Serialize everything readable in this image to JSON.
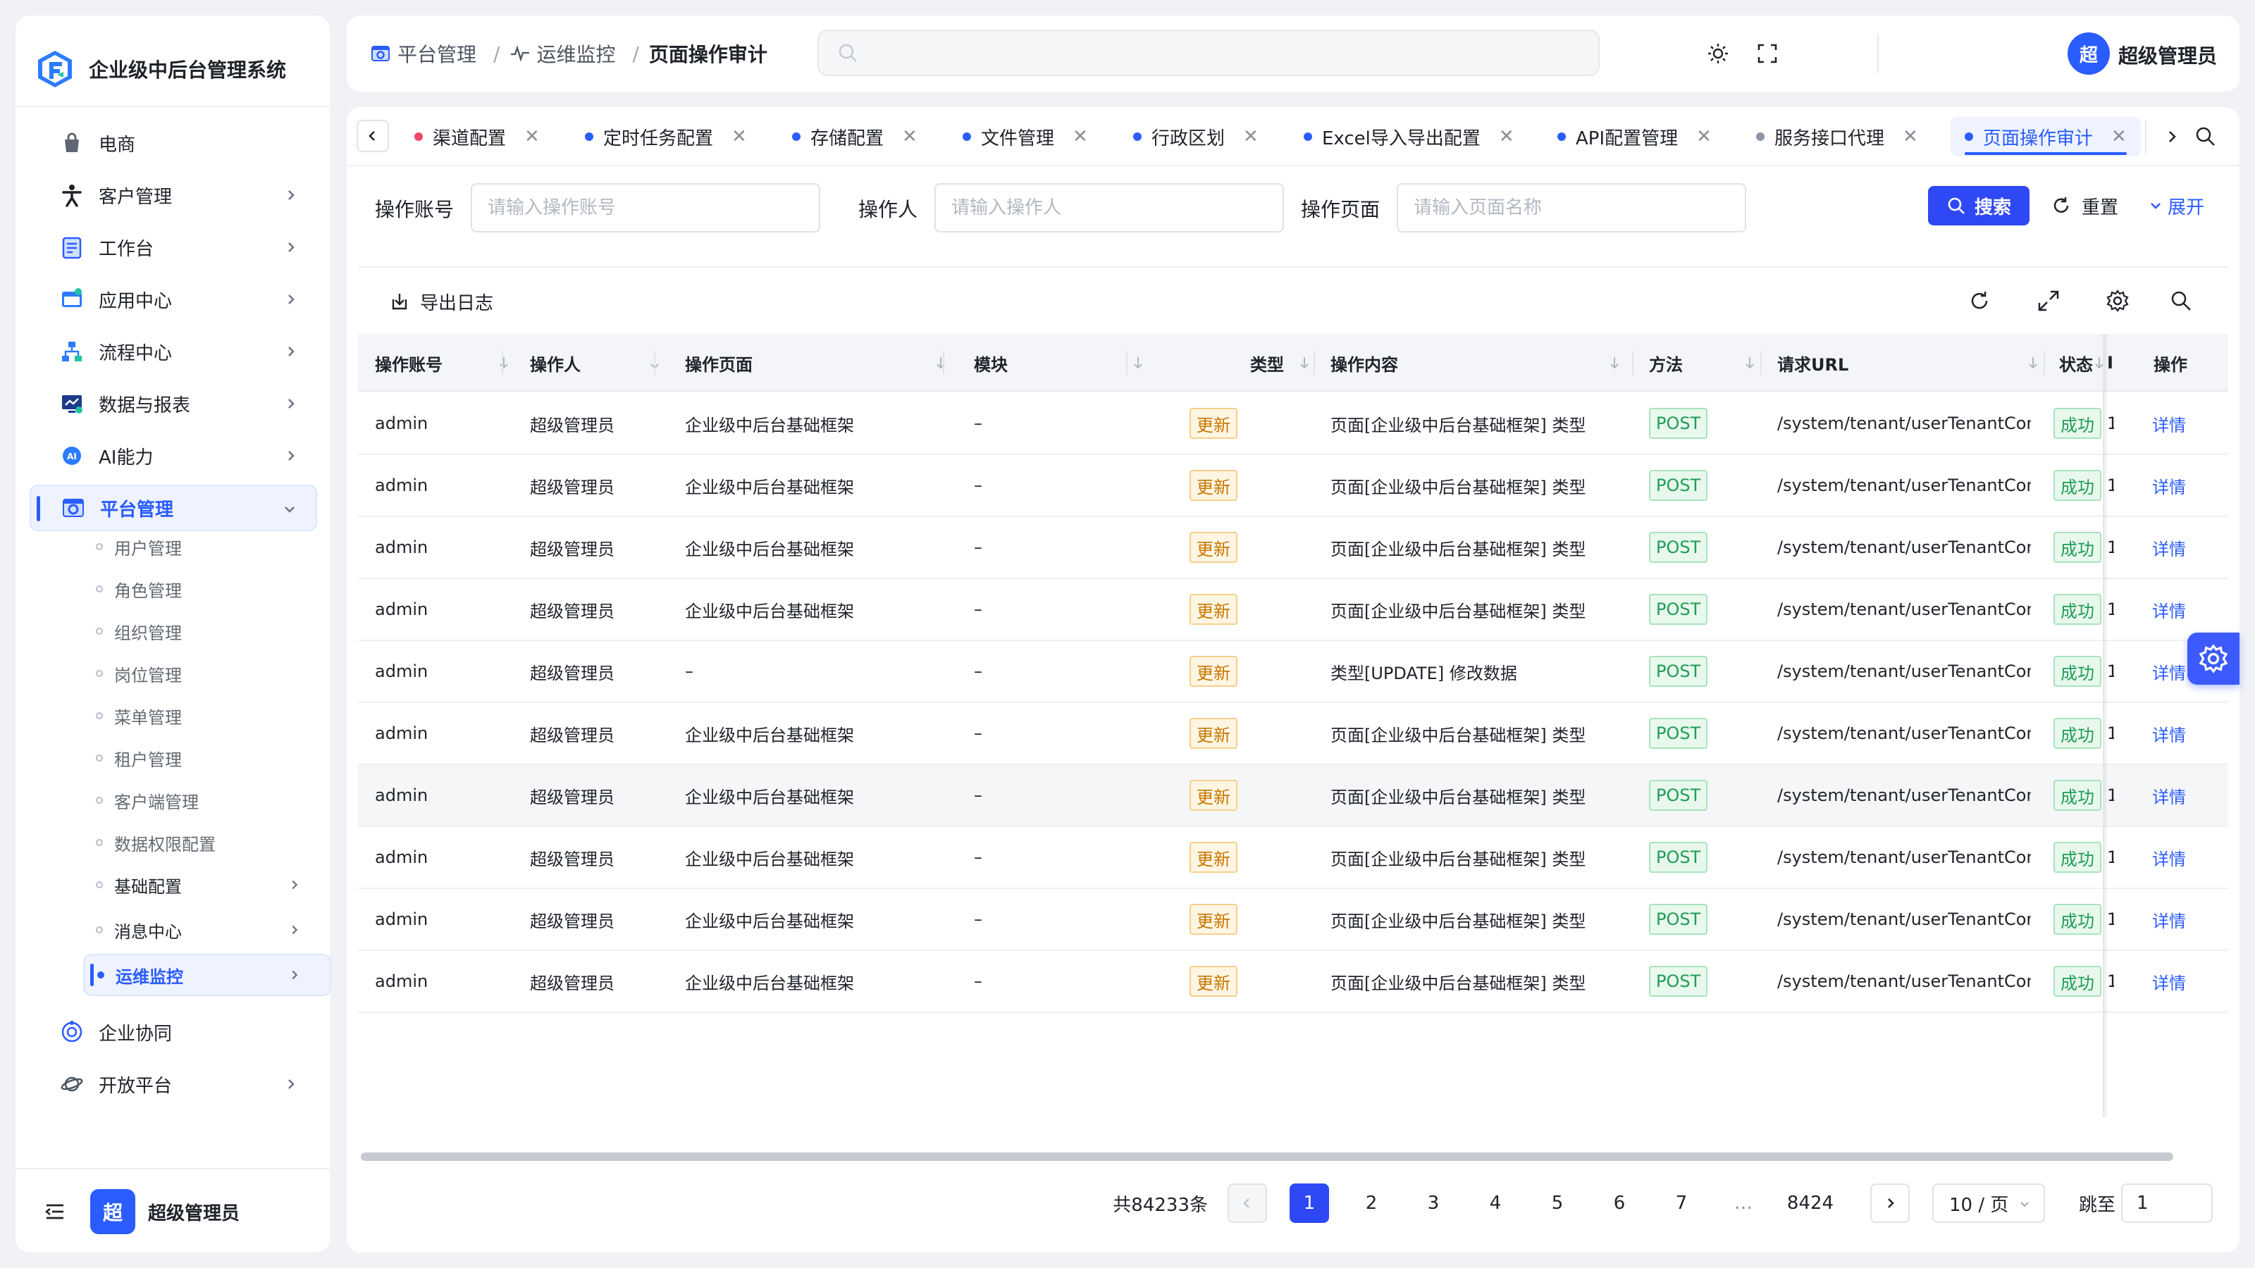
{
  "app": {
    "title": "企业级中后台管理系统",
    "accent": "#2b5cff"
  },
  "sidebar": {
    "items": [
      {
        "label": "电商",
        "icon": "shopping-bag-icon"
      },
      {
        "label": "客户管理",
        "icon": "person-icon"
      },
      {
        "label": "工作台",
        "icon": "clipboard-icon"
      },
      {
        "label": "应用中心",
        "icon": "app-window-icon"
      },
      {
        "label": "流程中心",
        "icon": "flow-icon"
      },
      {
        "label": "数据与报表",
        "icon": "chart-monitor-icon"
      },
      {
        "label": "AI能力",
        "icon": "ai-icon"
      },
      {
        "label": "平台管理",
        "icon": "platform-gear-icon"
      }
    ],
    "sub_items": [
      {
        "label": "用户管理"
      },
      {
        "label": "角色管理"
      },
      {
        "label": "组织管理"
      },
      {
        "label": "岗位管理"
      },
      {
        "label": "菜单管理"
      },
      {
        "label": "租户管理"
      },
      {
        "label": "客户端管理"
      },
      {
        "label": "数据权限配置"
      },
      {
        "label": "基础配置"
      },
      {
        "label": "消息中心"
      },
      {
        "label": "运维监控"
      }
    ],
    "bottom_items": [
      {
        "label": "企业协同",
        "icon": "collaboration-icon"
      },
      {
        "label": "开放平台",
        "icon": "planet-icon"
      }
    ],
    "footer": {
      "avatar_text": "超",
      "user_name": "超级管理员"
    }
  },
  "header": {
    "breadcrumb": [
      "平台管理",
      "运维监控",
      "页面操作审计"
    ],
    "avatar_text": "超",
    "user_name": "超级管理员"
  },
  "tabs": [
    {
      "label": "渠道配置",
      "dot_color": "#f0476b"
    },
    {
      "label": "定时任务配置",
      "dot_color": "#2b5cff"
    },
    {
      "label": "存储配置",
      "dot_color": "#2b5cff"
    },
    {
      "label": "文件管理",
      "dot_color": "#2b5cff"
    },
    {
      "label": "行政区划",
      "dot_color": "#2b5cff"
    },
    {
      "label": "Excel导入导出配置",
      "dot_color": "#2b5cff"
    },
    {
      "label": "API配置管理",
      "dot_color": "#2b5cff"
    },
    {
      "label": "服务接口代理",
      "dot_color": "#8d96a6"
    },
    {
      "label": "页面操作审计",
      "dot_color": "#2b5cff"
    }
  ],
  "filters": {
    "account_label": "操作账号",
    "account_placeholder": "请输入操作账号",
    "operator_label": "操作人",
    "operator_placeholder": "请输入操作人",
    "page_label": "操作页面",
    "page_placeholder": "请输入页面名称",
    "search_label": "搜索",
    "reset_label": "重置",
    "expand_label": "展开"
  },
  "toolbar": {
    "export_label": "导出日志"
  },
  "table": {
    "columns": [
      "操作账号",
      "操作人",
      "操作页面",
      "模块",
      "类型",
      "操作内容",
      "方法",
      "请求URL",
      "状态",
      "I",
      "操作"
    ],
    "rows": [
      {
        "account": "admin",
        "operator": "超级管理员",
        "page": "企业级中后台基础框架",
        "module": "–",
        "type": "更新",
        "content": "页面[企业级中后台基础框架] 类型",
        "method": "POST",
        "url": "/system/tenant/userTenantConf",
        "status": "成功",
        "extra": "1",
        "action": "详情"
      },
      {
        "account": "admin",
        "operator": "超级管理员",
        "page": "企业级中后台基础框架",
        "module": "–",
        "type": "更新",
        "content": "页面[企业级中后台基础框架] 类型",
        "method": "POST",
        "url": "/system/tenant/userTenantConf",
        "status": "成功",
        "extra": "1",
        "action": "详情"
      },
      {
        "account": "admin",
        "operator": "超级管理员",
        "page": "企业级中后台基础框架",
        "module": "–",
        "type": "更新",
        "content": "页面[企业级中后台基础框架] 类型",
        "method": "POST",
        "url": "/system/tenant/userTenantConf",
        "status": "成功",
        "extra": "1",
        "action": "详情"
      },
      {
        "account": "admin",
        "operator": "超级管理员",
        "page": "企业级中后台基础框架",
        "module": "–",
        "type": "更新",
        "content": "页面[企业级中后台基础框架] 类型",
        "method": "POST",
        "url": "/system/tenant/userTenantConf",
        "status": "成功",
        "extra": "1",
        "action": "详情"
      },
      {
        "account": "admin",
        "operator": "超级管理员",
        "page": "–",
        "module": "–",
        "type": "更新",
        "content": "类型[UPDATE] 修改数据",
        "method": "POST",
        "url": "/system/tenant/userTenantConf",
        "status": "成功",
        "extra": "1",
        "action": "详情"
      },
      {
        "account": "admin",
        "operator": "超级管理员",
        "page": "企业级中后台基础框架",
        "module": "–",
        "type": "更新",
        "content": "页面[企业级中后台基础框架] 类型",
        "method": "POST",
        "url": "/system/tenant/userTenantConf",
        "status": "成功",
        "extra": "1",
        "action": "详情"
      },
      {
        "account": "admin",
        "operator": "超级管理员",
        "page": "企业级中后台基础框架",
        "module": "–",
        "type": "更新",
        "content": "页面[企业级中后台基础框架] 类型",
        "method": "POST",
        "url": "/system/tenant/userTenantConf",
        "status": "成功",
        "extra": "1",
        "action": "详情"
      },
      {
        "account": "admin",
        "operator": "超级管理员",
        "page": "企业级中后台基础框架",
        "module": "–",
        "type": "更新",
        "content": "页面[企业级中后台基础框架] 类型",
        "method": "POST",
        "url": "/system/tenant/userTenantConf",
        "status": "成功",
        "extra": "1",
        "action": "详情"
      },
      {
        "account": "admin",
        "operator": "超级管理员",
        "page": "企业级中后台基础框架",
        "module": "–",
        "type": "更新",
        "content": "页面[企业级中后台基础框架] 类型",
        "method": "POST",
        "url": "/system/tenant/userTenantConf",
        "status": "成功",
        "extra": "1",
        "action": "详情"
      },
      {
        "account": "admin",
        "operator": "超级管理员",
        "page": "企业级中后台基础框架",
        "module": "–",
        "type": "更新",
        "content": "页面[企业级中后台基础框架] 类型",
        "method": "POST",
        "url": "/system/tenant/userTenantConf",
        "status": "成功",
        "extra": "1",
        "action": "详情"
      }
    ]
  },
  "pagination": {
    "total_text": "共84233条",
    "pages": [
      "1",
      "2",
      "3",
      "4",
      "5",
      "6",
      "7",
      "…",
      "8424"
    ],
    "page_size_text": "10 / 页",
    "jump_label": "跳至",
    "jump_value": "1"
  }
}
